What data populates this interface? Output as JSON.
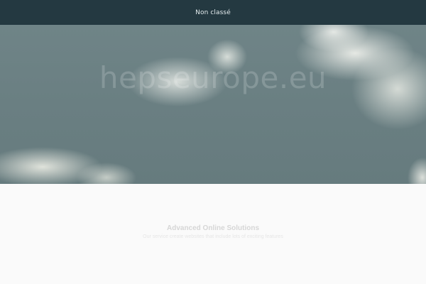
{
  "nav": {
    "items": [
      {
        "label": "Non classé"
      }
    ]
  },
  "hero": {
    "watermark_text": "hepseurope.eu"
  },
  "main": {
    "headline": "Advanced Online Solutions",
    "tagline": "Our service create websites that include lots of exciting features"
  },
  "colors": {
    "topbar": "#243941",
    "background": "#fafafa"
  }
}
